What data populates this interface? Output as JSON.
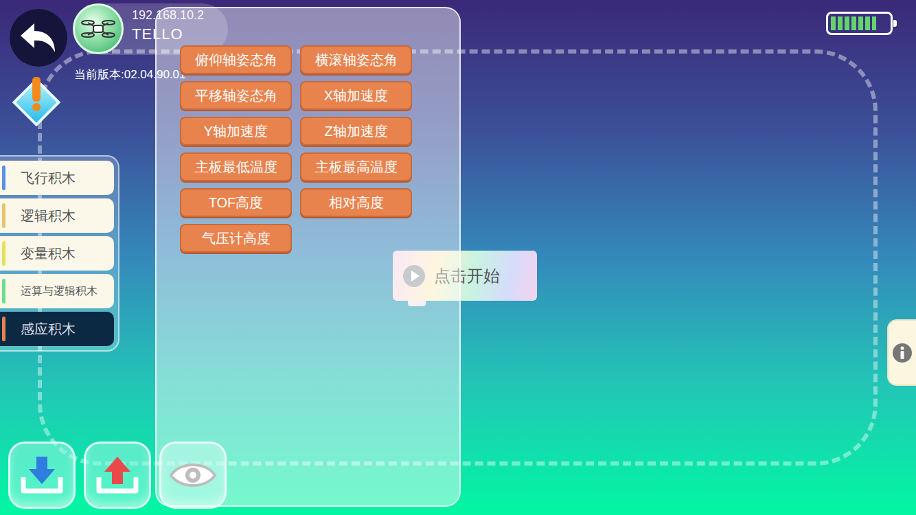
{
  "header": {
    "ip": "192.168.10.2",
    "name": "TELLO",
    "version": "当前版本:02.04.90.01"
  },
  "battery": {
    "level": 0.8
  },
  "categories": [
    {
      "label": "飞行积木",
      "selected": false,
      "color": "#5b8fe8"
    },
    {
      "label": "逻辑积木",
      "selected": false,
      "color": "#e8c46a"
    },
    {
      "label": "变量积木",
      "selected": false,
      "color": "#e6e05a"
    },
    {
      "label": "运算与逻辑积木",
      "selected": false,
      "color": "#6fdc8c"
    },
    {
      "label": "感应积木",
      "selected": true,
      "color": "#e8834e"
    }
  ],
  "blocks": [
    "俯仰轴姿态角",
    "横滚轴姿态角",
    "平移轴姿态角",
    "X轴加速度",
    "Y轴加速度",
    "Z轴加速度",
    "主板最低温度",
    "主板最高温度",
    "TOF高度",
    "相对高度",
    "气压计高度"
  ],
  "start": {
    "label": "点击开始"
  }
}
